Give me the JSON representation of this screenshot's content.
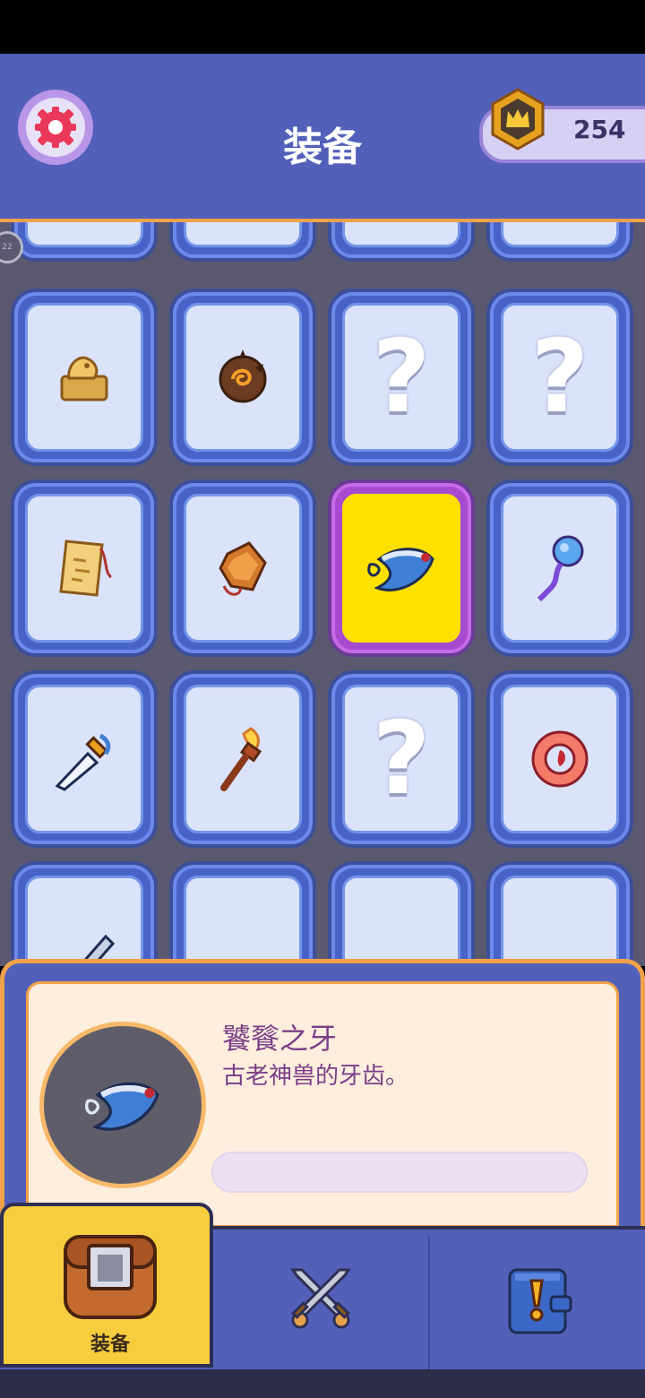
{
  "header": {
    "title": "装备",
    "coins": "254"
  },
  "grid": {
    "badge": "22",
    "rows": [
      [
        {
          "icon": "partial-slot"
        },
        {
          "icon": "partial-slot"
        },
        {
          "icon": "partial-slot"
        },
        {
          "icon": "partial-slot"
        }
      ],
      [
        {
          "icon": "dragon-seal-icon"
        },
        {
          "icon": "spiked-orb-icon"
        },
        {
          "icon": "unknown",
          "label": "?"
        },
        {
          "icon": "unknown",
          "label": "?"
        }
      ],
      [
        {
          "icon": "scroll-icon"
        },
        {
          "icon": "amulet-icon"
        },
        {
          "icon": "beast-fang-icon",
          "selected": true
        },
        {
          "icon": "magic-staff-icon"
        }
      ],
      [
        {
          "icon": "dagger-icon"
        },
        {
          "icon": "torch-icon"
        },
        {
          "icon": "unknown",
          "label": "?"
        },
        {
          "icon": "ring-icon"
        }
      ],
      [
        {
          "icon": "sword-icon"
        },
        {
          "icon": "white-wings-icon"
        },
        {
          "icon": "dark-wings-icon"
        },
        {
          "icon": "unknown",
          "label": "?"
        }
      ]
    ]
  },
  "details": {
    "name": "饕餮之牙",
    "description": "古老神兽的牙齿。"
  },
  "nav": {
    "equip_label": "装备"
  },
  "colors": {
    "header": "#5260b9",
    "accent": "#f0a24a",
    "selected": "#ffe100"
  }
}
